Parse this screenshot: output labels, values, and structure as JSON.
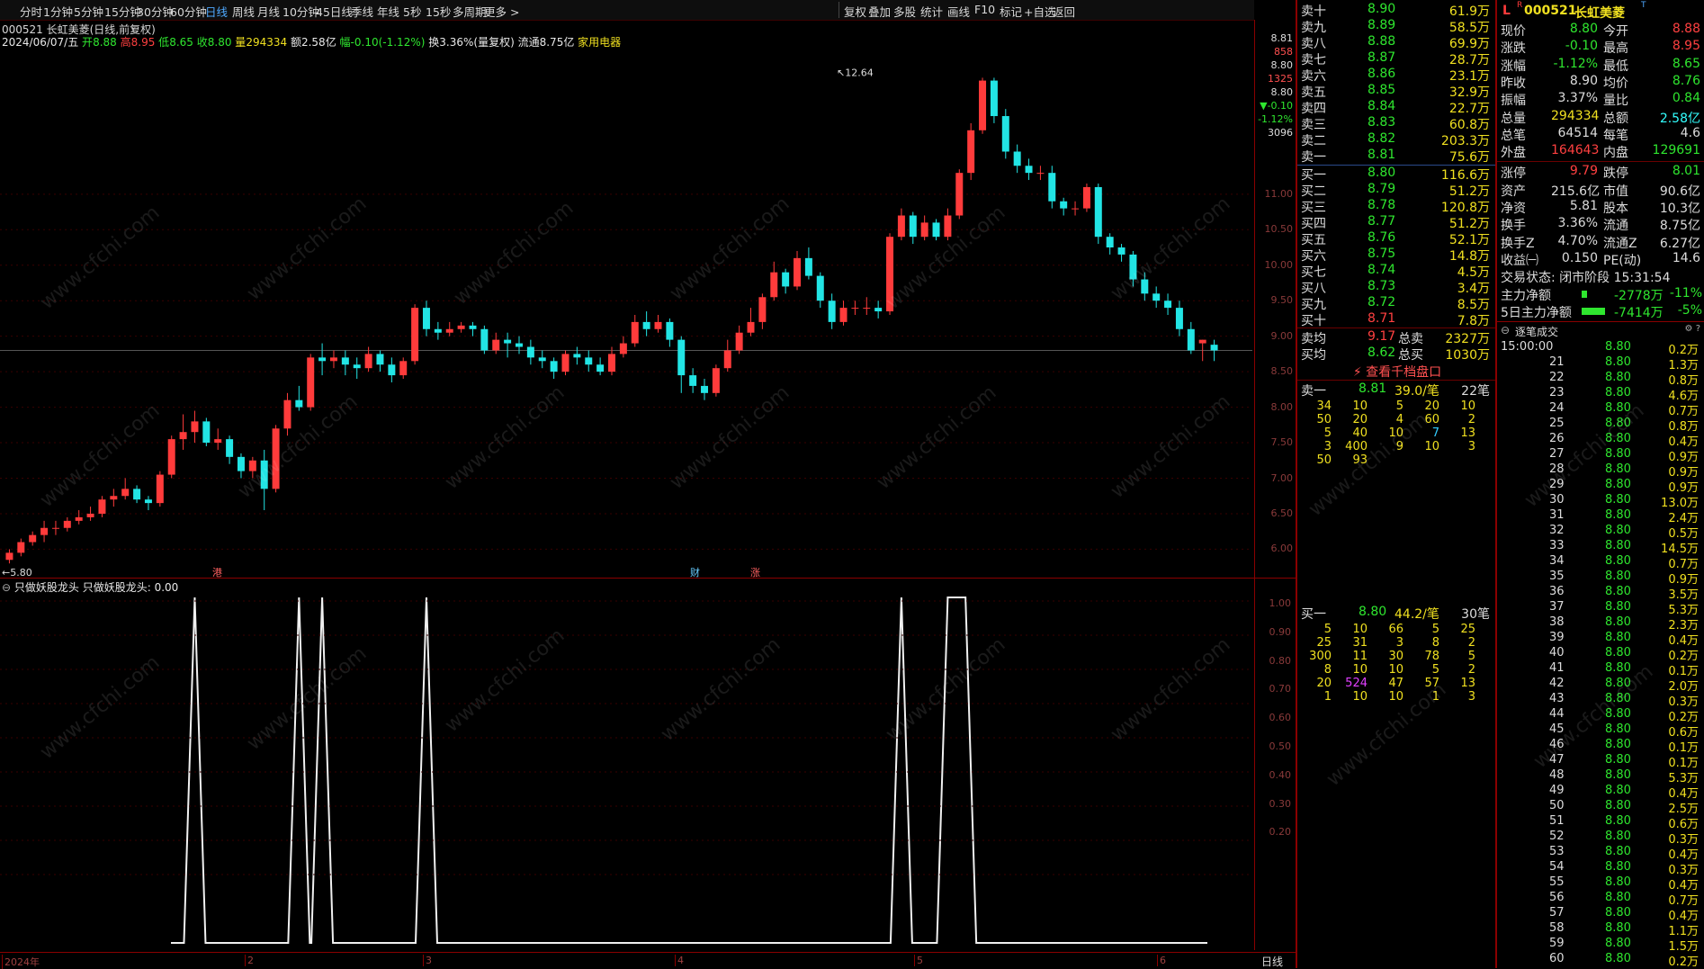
{
  "toolbar": {
    "periods": [
      "分时",
      "1分钟",
      "5分钟",
      "15分钟",
      "30分钟",
      "60分钟",
      "日线",
      "周线",
      "月线",
      "10分钟",
      "45日线",
      "季线",
      "年线",
      "5秒",
      "15秒",
      "多周期",
      "更多 >"
    ],
    "active_period": "日线",
    "right_buttons": [
      "复权",
      "叠加",
      "多股",
      "统计",
      "画线",
      "F10",
      "标记",
      "+自选",
      "返回"
    ]
  },
  "chart_header": {
    "title": "000521 长虹美菱(日线,前复权)",
    "date": "2024/06/07/五",
    "open_label": "开",
    "open": "8.88",
    "high_label": "高",
    "high": "8.95",
    "low_label": "低",
    "low": "8.65",
    "close_label": "收",
    "close": "8.80",
    "volume_label": "量",
    "volume": "294334",
    "amount_label": "额",
    "amount": "2.58亿",
    "change_label": "幅",
    "change": "-0.10(-1.12%)",
    "turnover_label": "换",
    "turnover": "3.36%(量复权)",
    "float_label": "流通",
    "float": "8.75亿",
    "sector": "家用电器"
  },
  "price_axis": [
    "11.00",
    "10.50",
    "10.00",
    "9.50",
    "9.00",
    "8.50",
    "8.00",
    "7.50",
    "7.00",
    "6.50",
    "6.00"
  ],
  "price_axis_top": [
    "8.81",
    "858",
    "8.80",
    "1325",
    "8.80",
    "▼-0.10",
    "-1.12%",
    "3096"
  ],
  "sub_axis": [
    "1.00",
    "0.90",
    "0.80",
    "0.70",
    "0.60",
    "0.50",
    "0.40",
    "0.30",
    "0.20"
  ],
  "annotations": {
    "high_mark": "12.64",
    "low_mark": "5.80",
    "events": [
      "港",
      "财",
      "涨"
    ]
  },
  "indicator": {
    "title": "只做妖股龙头",
    "value_label": "只做妖股龙头: 0.00"
  },
  "bottom_axis": {
    "labels": [
      "2024年",
      "2",
      "3",
      "4",
      "5",
      "6"
    ],
    "period": "日线"
  },
  "chart_data": {
    "type": "candlestick",
    "ylim": [
      5.6,
      13.0
    ],
    "candles": [
      [
        5.85,
        5.95,
        5.8,
        6.0
      ],
      [
        5.95,
        6.1,
        5.9,
        6.15
      ],
      [
        6.1,
        6.2,
        6.05,
        6.25
      ],
      [
        6.2,
        6.3,
        6.1,
        6.4
      ],
      [
        6.3,
        6.3,
        6.2,
        6.4
      ],
      [
        6.3,
        6.4,
        6.25,
        6.45
      ],
      [
        6.4,
        6.45,
        6.35,
        6.55
      ],
      [
        6.45,
        6.5,
        6.4,
        6.6
      ],
      [
        6.5,
        6.7,
        6.45,
        6.75
      ],
      [
        6.7,
        6.75,
        6.6,
        6.85
      ],
      [
        6.75,
        6.85,
        6.7,
        7.0
      ],
      [
        6.85,
        6.7,
        6.65,
        6.9
      ],
      [
        6.7,
        6.65,
        6.55,
        6.75
      ],
      [
        6.65,
        7.05,
        6.6,
        7.1
      ],
      [
        7.05,
        7.55,
        7.0,
        7.6
      ],
      [
        7.55,
        7.65,
        7.4,
        7.9
      ],
      [
        7.65,
        7.8,
        7.5,
        7.95
      ],
      [
        7.8,
        7.5,
        7.45,
        7.85
      ],
      [
        7.5,
        7.55,
        7.4,
        7.7
      ],
      [
        7.55,
        7.3,
        7.2,
        7.6
      ],
      [
        7.3,
        7.1,
        7.0,
        7.35
      ],
      [
        7.1,
        7.25,
        7.0,
        7.3
      ],
      [
        7.25,
        6.85,
        6.55,
        7.4
      ],
      [
        6.85,
        7.7,
        6.8,
        7.75
      ],
      [
        7.7,
        8.1,
        7.6,
        8.2
      ],
      [
        8.1,
        8.0,
        7.95,
        8.3
      ],
      [
        8.0,
        8.7,
        7.95,
        8.75
      ],
      [
        8.7,
        8.65,
        8.45,
        8.9
      ],
      [
        8.65,
        8.7,
        8.55,
        8.8
      ],
      [
        8.7,
        8.6,
        8.45,
        8.8
      ],
      [
        8.6,
        8.55,
        8.4,
        8.7
      ],
      [
        8.55,
        8.75,
        8.5,
        8.85
      ],
      [
        8.75,
        8.6,
        8.5,
        8.8
      ],
      [
        8.6,
        8.45,
        8.35,
        8.7
      ],
      [
        8.45,
        8.65,
        8.4,
        8.7
      ],
      [
        8.65,
        9.4,
        8.6,
        9.45
      ],
      [
        9.4,
        9.1,
        9.0,
        9.5
      ],
      [
        9.1,
        9.05,
        8.95,
        9.2
      ],
      [
        9.05,
        9.1,
        9.0,
        9.2
      ],
      [
        9.1,
        9.15,
        9.05,
        9.2
      ],
      [
        9.15,
        9.1,
        9.0,
        9.2
      ],
      [
        9.1,
        8.8,
        8.75,
        9.15
      ],
      [
        8.8,
        8.95,
        8.75,
        9.05
      ],
      [
        8.95,
        8.9,
        8.7,
        9.05
      ],
      [
        8.9,
        8.85,
        8.75,
        9.0
      ],
      [
        8.85,
        8.7,
        8.6,
        8.95
      ],
      [
        8.7,
        8.65,
        8.55,
        8.8
      ],
      [
        8.65,
        8.5,
        8.4,
        8.7
      ],
      [
        8.5,
        8.75,
        8.45,
        8.8
      ],
      [
        8.75,
        8.7,
        8.6,
        8.85
      ],
      [
        8.7,
        8.6,
        8.5,
        8.8
      ],
      [
        8.6,
        8.5,
        8.45,
        8.7
      ],
      [
        8.5,
        8.75,
        8.45,
        8.85
      ],
      [
        8.75,
        8.9,
        8.7,
        9.0
      ],
      [
        8.9,
        9.2,
        8.85,
        9.3
      ],
      [
        9.2,
        9.1,
        9.0,
        9.35
      ],
      [
        9.1,
        9.2,
        9.05,
        9.3
      ],
      [
        9.2,
        8.95,
        8.85,
        9.25
      ],
      [
        8.95,
        8.45,
        8.2,
        9.0
      ],
      [
        8.45,
        8.3,
        8.2,
        8.55
      ],
      [
        8.3,
        8.2,
        8.1,
        8.4
      ],
      [
        8.2,
        8.55,
        8.15,
        8.6
      ],
      [
        8.55,
        8.8,
        8.5,
        8.95
      ],
      [
        8.8,
        9.05,
        8.75,
        9.15
      ],
      [
        9.05,
        9.2,
        9.0,
        9.4
      ],
      [
        9.2,
        9.55,
        9.1,
        9.6
      ],
      [
        9.55,
        9.9,
        9.5,
        10.05
      ],
      [
        9.9,
        9.7,
        9.6,
        9.95
      ],
      [
        9.7,
        10.1,
        9.65,
        10.2
      ],
      [
        10.1,
        9.85,
        9.8,
        10.25
      ],
      [
        9.85,
        9.5,
        9.4,
        9.9
      ],
      [
        9.5,
        9.2,
        9.1,
        9.6
      ],
      [
        9.2,
        9.4,
        9.15,
        9.5
      ],
      [
        9.4,
        9.4,
        9.3,
        9.5
      ],
      [
        9.4,
        9.4,
        9.3,
        9.55
      ],
      [
        9.4,
        9.35,
        9.25,
        9.5
      ],
      [
        9.35,
        10.4,
        9.3,
        10.45
      ],
      [
        10.4,
        10.7,
        10.35,
        10.8
      ],
      [
        10.7,
        10.4,
        10.3,
        10.75
      ],
      [
        10.4,
        10.6,
        10.35,
        10.7
      ],
      [
        10.6,
        10.4,
        10.35,
        10.65
      ],
      [
        10.4,
        10.7,
        10.35,
        10.8
      ],
      [
        10.7,
        11.3,
        10.65,
        11.35
      ],
      [
        11.3,
        11.9,
        11.2,
        12.0
      ],
      [
        11.9,
        12.6,
        11.85,
        12.64
      ],
      [
        12.6,
        12.1,
        12.0,
        12.64
      ],
      [
        12.1,
        11.6,
        11.5,
        12.2
      ],
      [
        11.6,
        11.4,
        11.3,
        11.7
      ],
      [
        11.4,
        11.3,
        11.2,
        11.5
      ],
      [
        11.3,
        11.3,
        11.2,
        11.4
      ],
      [
        11.3,
        10.9,
        10.8,
        11.4
      ],
      [
        10.9,
        10.8,
        10.7,
        10.95
      ],
      [
        10.8,
        10.8,
        10.7,
        10.9
      ],
      [
        10.8,
        11.1,
        10.75,
        11.15
      ],
      [
        11.1,
        10.4,
        10.3,
        11.15
      ],
      [
        10.4,
        10.25,
        10.15,
        10.45
      ],
      [
        10.25,
        10.15,
        10.05,
        10.3
      ],
      [
        10.15,
        9.8,
        9.7,
        10.2
      ],
      [
        9.8,
        9.6,
        9.5,
        9.9
      ],
      [
        9.6,
        9.5,
        9.4,
        9.7
      ],
      [
        9.5,
        9.4,
        9.3,
        9.6
      ],
      [
        9.4,
        9.1,
        9.0,
        9.5
      ],
      [
        9.1,
        8.8,
        8.75,
        9.2
      ],
      [
        8.9,
        8.95,
        8.65,
        8.95
      ],
      [
        8.88,
        8.8,
        8.65,
        8.95
      ]
    ],
    "indicator": {
      "name": "只做妖股龙头",
      "spikes": [
        [
          16,
          17
        ],
        [
          25,
          26
        ],
        [
          27,
          28
        ],
        [
          36,
          37
        ],
        [
          77,
          78
        ],
        [
          81,
          83
        ]
      ]
    }
  },
  "quote": {
    "sells": [
      [
        "卖十",
        "8.90",
        "61.9万"
      ],
      [
        "卖九",
        "8.89",
        "58.5万"
      ],
      [
        "卖八",
        "8.88",
        "69.9万"
      ],
      [
        "卖七",
        "8.87",
        "28.7万"
      ],
      [
        "卖六",
        "8.86",
        "23.1万"
      ],
      [
        "卖五",
        "8.85",
        "32.9万"
      ],
      [
        "卖四",
        "8.84",
        "22.7万"
      ],
      [
        "卖三",
        "8.83",
        "60.8万"
      ],
      [
        "卖二",
        "8.82",
        "203.3万"
      ],
      [
        "卖一",
        "8.81",
        "75.6万"
      ]
    ],
    "buys": [
      [
        "买一",
        "8.80",
        "116.6万"
      ],
      [
        "买二",
        "8.79",
        "51.2万"
      ],
      [
        "买三",
        "8.78",
        "120.8万"
      ],
      [
        "买四",
        "8.77",
        "51.2万"
      ],
      [
        "买五",
        "8.76",
        "52.1万"
      ],
      [
        "买六",
        "8.75",
        "14.8万"
      ],
      [
        "买七",
        "8.74",
        "4.5万"
      ],
      [
        "买八",
        "8.73",
        "3.4万"
      ],
      [
        "买九",
        "8.72",
        "8.5万"
      ],
      [
        "买十",
        "8.71",
        "7.8万"
      ]
    ],
    "avg_sell": {
      "label": "卖均",
      "price": "9.17",
      "total_label": "总卖",
      "total": "2327万"
    },
    "avg_buy": {
      "label": "买均",
      "price": "8.62",
      "total_label": "总买",
      "total": "1030万"
    },
    "view_depth": "查看千档盘口",
    "sell1_queue": {
      "label": "卖一",
      "price": "8.81",
      "avg": "39.0/笔",
      "count": "22笔",
      "rows": [
        [
          "34",
          "10",
          "5",
          "20",
          "10"
        ],
        [
          "50",
          "20",
          "4",
          "60",
          "2"
        ],
        [
          "5",
          "40",
          "10",
          "7",
          "13"
        ],
        [
          "3",
          "400",
          "9",
          "10",
          "3"
        ],
        [
          "50",
          "93",
          "",
          "",
          ""
        ]
      ]
    },
    "buy1_queue": {
      "label": "买一",
      "price": "8.80",
      "avg": "44.2/笔",
      "count": "30笔",
      "rows": [
        [
          "5",
          "10",
          "66",
          "5",
          "25"
        ],
        [
          "25",
          "31",
          "3",
          "8",
          "2"
        ],
        [
          "300",
          "11",
          "30",
          "78",
          "5"
        ],
        [
          "8",
          "10",
          "10",
          "5",
          "2"
        ],
        [
          "20",
          "524",
          "47",
          "57",
          "13"
        ],
        [
          "1",
          "10",
          "10",
          "1",
          "3"
        ]
      ]
    }
  },
  "stock": {
    "code": "000521",
    "name": "长虹美菱",
    "flag_l": "L",
    "flag_r": "R",
    "flag_t": "T",
    "stats": [
      [
        "现价",
        "8.80",
        "今开",
        "8.88"
      ],
      [
        "涨跌",
        "-0.10",
        "最高",
        "8.95"
      ],
      [
        "涨幅",
        "-1.12%",
        "最低",
        "8.65"
      ],
      [
        "昨收",
        "8.90",
        "均价",
        "8.76"
      ],
      [
        "振幅",
        "3.37%",
        "量比",
        "0.84"
      ],
      [
        "总量",
        "294334",
        "总额",
        "2.58亿"
      ],
      [
        "总笔",
        "64514",
        "每笔",
        "4.6"
      ],
      [
        "外盘",
        "164643",
        "内盘",
        "129691"
      ],
      [
        "涨停",
        "9.79",
        "跌停",
        "8.01"
      ],
      [
        "资产",
        "215.6亿",
        "市值",
        "90.6亿"
      ],
      [
        "净资",
        "5.81",
        "股本",
        "10.3亿"
      ],
      [
        "换手",
        "3.36%",
        "流通",
        "8.75亿"
      ],
      [
        "换手Z",
        "4.70%",
        "流通Z",
        "6.27亿"
      ],
      [
        "收益㈠",
        "0.150",
        "PE(动)",
        "14.6"
      ]
    ],
    "trade_status": "交易状态: 闭市阶段 15:31:54",
    "main_net_label": "主力净额",
    "main_net": "-2778万",
    "main_net_pct": "-11%",
    "main5_label": "5日主力净额",
    "main5": "-7414万",
    "main5_pct": "-5%",
    "ticks_title": "逐笔成交",
    "ticks": [
      [
        "15:00:00",
        "8.80",
        "0.2万"
      ],
      [
        "21",
        "8.80",
        "1.3万"
      ],
      [
        "22",
        "8.80",
        "0.8万"
      ],
      [
        "23",
        "8.80",
        "4.6万"
      ],
      [
        "24",
        "8.80",
        "0.7万"
      ],
      [
        "25",
        "8.80",
        "0.8万"
      ],
      [
        "26",
        "8.80",
        "0.4万"
      ],
      [
        "27",
        "8.80",
        "0.9万"
      ],
      [
        "28",
        "8.80",
        "0.9万"
      ],
      [
        "29",
        "8.80",
        "0.9万"
      ],
      [
        "30",
        "8.80",
        "13.0万"
      ],
      [
        "31",
        "8.80",
        "2.4万"
      ],
      [
        "32",
        "8.80",
        "0.5万"
      ],
      [
        "33",
        "8.80",
        "14.5万"
      ],
      [
        "34",
        "8.80",
        "0.7万"
      ],
      [
        "35",
        "8.80",
        "0.9万"
      ],
      [
        "36",
        "8.80",
        "3.5万"
      ],
      [
        "37",
        "8.80",
        "5.3万"
      ],
      [
        "38",
        "8.80",
        "2.3万"
      ],
      [
        "39",
        "8.80",
        "0.4万"
      ],
      [
        "40",
        "8.80",
        "0.2万"
      ],
      [
        "41",
        "8.80",
        "0.1万"
      ],
      [
        "42",
        "8.80",
        "2.0万"
      ],
      [
        "43",
        "8.80",
        "0.3万"
      ],
      [
        "44",
        "8.80",
        "0.2万"
      ],
      [
        "45",
        "8.80",
        "0.6万"
      ],
      [
        "46",
        "8.80",
        "0.1万"
      ],
      [
        "47",
        "8.80",
        "0.1万"
      ],
      [
        "48",
        "8.80",
        "5.3万"
      ],
      [
        "49",
        "8.80",
        "0.4万"
      ],
      [
        "50",
        "8.80",
        "2.5万"
      ],
      [
        "51",
        "8.80",
        "0.6万"
      ],
      [
        "52",
        "8.80",
        "0.3万"
      ],
      [
        "53",
        "8.80",
        "0.4万"
      ],
      [
        "54",
        "8.80",
        "0.3万"
      ],
      [
        "55",
        "8.80",
        "0.4万"
      ],
      [
        "56",
        "8.80",
        "0.7万"
      ],
      [
        "57",
        "8.80",
        "0.4万"
      ],
      [
        "58",
        "8.80",
        "1.1万"
      ],
      [
        "59",
        "8.80",
        "1.5万"
      ],
      [
        "60",
        "8.80",
        "0.2万"
      ]
    ]
  },
  "watermark": "www.cfchi.com",
  "colors": {
    "up": "#ff3b3b",
    "down": "#22e5e5",
    "bg": "#000000",
    "frame": "#8a0000"
  }
}
